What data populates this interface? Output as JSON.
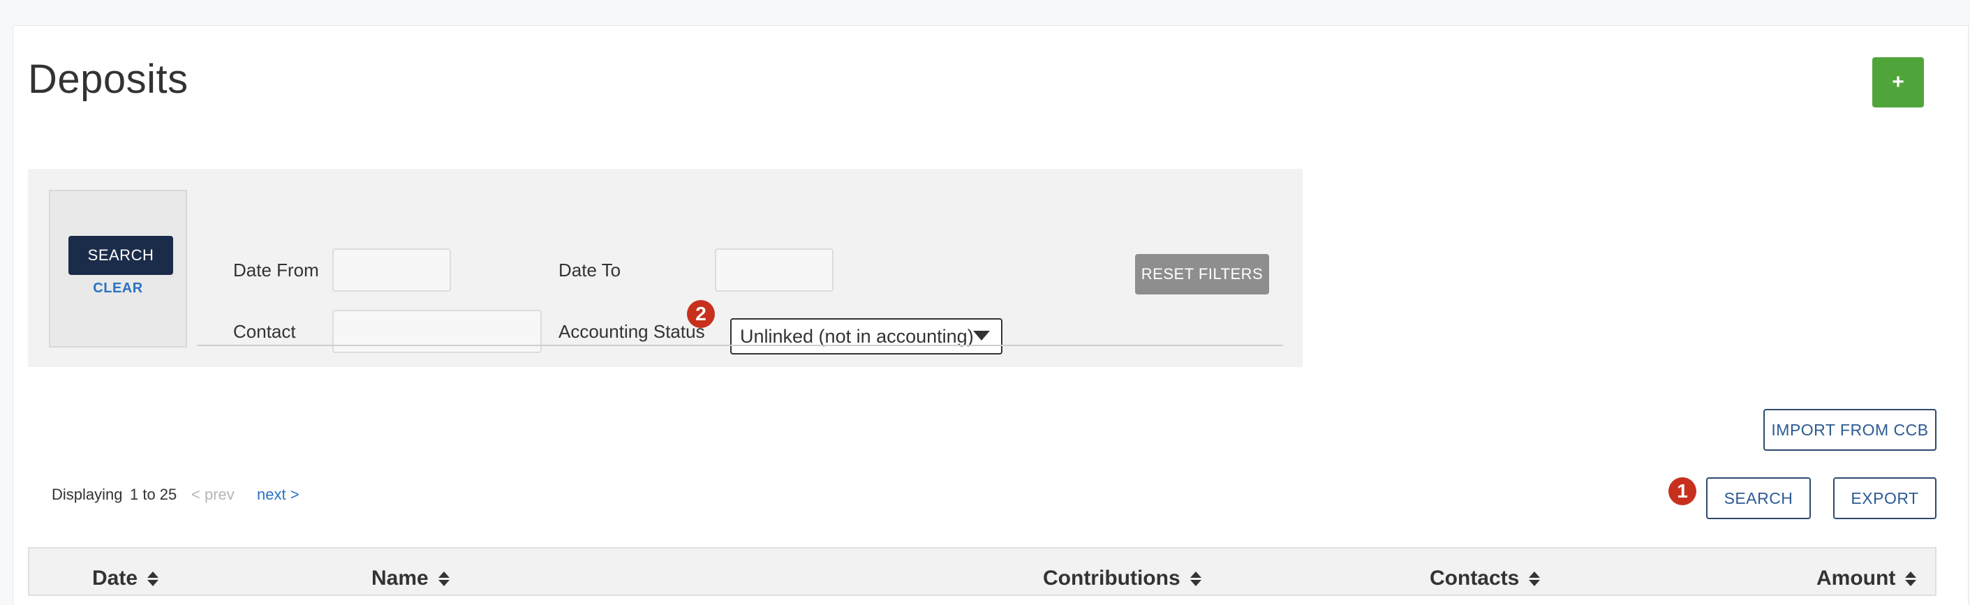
{
  "header": {
    "title": "Deposits",
    "add_label": "+"
  },
  "filters": {
    "search_label": "SEARCH",
    "clear_label": "CLEAR",
    "date_from_label": "Date From",
    "date_from_value": "",
    "date_to_label": "Date To",
    "date_to_value": "",
    "contact_label": "Contact",
    "contact_value": "",
    "accounting_status_label": "Accounting Status",
    "accounting_status_value": "Unlinked (not in accounting)",
    "reset_label": "RESET FILTERS"
  },
  "actions": {
    "import_label": "IMPORT FROM CCB",
    "search_label": "SEARCH",
    "export_label": "EXPORT"
  },
  "badges": {
    "one": "1",
    "two": "2"
  },
  "paging": {
    "displaying_label": "Displaying",
    "range": "1 to 25",
    "prev_label": "< prev",
    "next_label": "next >"
  },
  "table": {
    "columns": [
      "Date",
      "Name",
      "Contributions",
      "Contacts",
      "Amount"
    ]
  },
  "colors": {
    "accent_green": "#4fa53a",
    "primary_navy": "#1b2c4a",
    "badge_red": "#c8301e",
    "link_blue": "#2a72c2"
  }
}
